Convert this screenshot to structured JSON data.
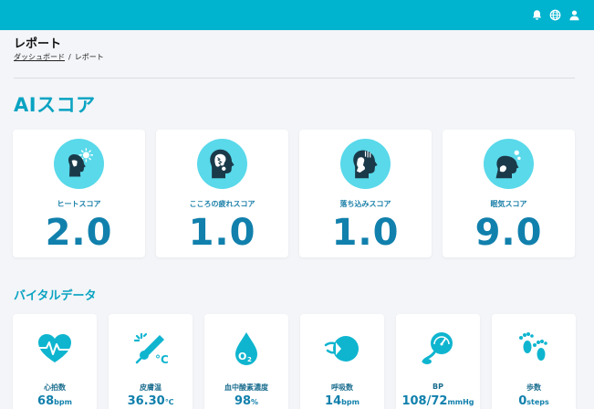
{
  "header": {
    "icons": [
      "bell-icon",
      "globe-icon",
      "user-icon"
    ],
    "color": "#00b3cf"
  },
  "page": {
    "title": "レポート",
    "breadcrumb": {
      "home": "ダッシュボード",
      "separator": "/",
      "current": "レポート"
    }
  },
  "ai_score": {
    "title": "AIスコア",
    "cards": [
      {
        "label": "ヒートスコア",
        "value": "2.0",
        "icon": "heat-stress-icon"
      },
      {
        "label": "こころの疲れスコア",
        "value": "1.0",
        "icon": "mental-fatigue-icon"
      },
      {
        "label": "落ち込みスコア",
        "value": "1.0",
        "icon": "depression-icon"
      },
      {
        "label": "眠気スコア",
        "value": "9.0",
        "icon": "sleepiness-icon"
      }
    ]
  },
  "vitals": {
    "title": "バイタルデータ",
    "cards": [
      {
        "label": "心拍数",
        "value": "68",
        "unit": "bpm",
        "icon": "heart-rate-icon"
      },
      {
        "label": "皮膚温",
        "value": "36.30",
        "unit": "℃",
        "icon": "thermometer-icon"
      },
      {
        "label": "血中酸素濃度",
        "value": "98",
        "unit": "%",
        "icon": "oxygen-drop-icon"
      },
      {
        "label": "呼吸数",
        "value": "14",
        "unit": "bpm",
        "icon": "breathing-icon"
      },
      {
        "label": "BP",
        "value": "108/72",
        "unit": "mmHg",
        "icon": "blood-pressure-icon"
      },
      {
        "label": "歩数",
        "value": "0",
        "unit": "steps",
        "icon": "footprints-icon"
      }
    ]
  },
  "colors": {
    "accent": "#0aa3c2",
    "value": "#1180ac",
    "icon_bg": "#59d9ea",
    "icon": "#0fb5cf"
  }
}
